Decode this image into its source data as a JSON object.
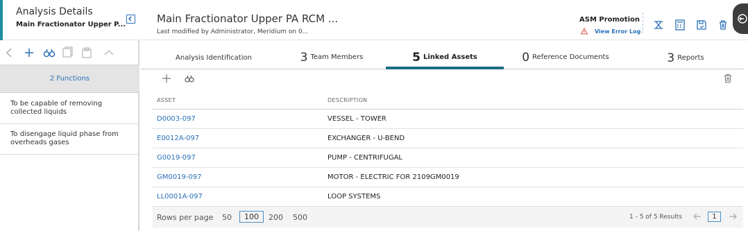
{
  "left_panel": {
    "title": "Analysis Details",
    "subtitle": "Main Fractionator Upper P...",
    "functions_header": "2 Functions",
    "functions": [
      "To be capable of removing collected liquids",
      "To disengage liquid phase from overheads gases"
    ]
  },
  "header": {
    "title": "Main Fractionator Upper PA RCM ...",
    "subtitle": "Last modified by Administrator, Meridium on 0...",
    "promotion_label": "ASM Promotion",
    "error_log_link": "View Error Log"
  },
  "tabs": [
    {
      "count": "",
      "label": "Analysis Identification"
    },
    {
      "count": "3",
      "label": "Team Members"
    },
    {
      "count": "5",
      "label": "Linked Assets"
    },
    {
      "count": "0",
      "label": "Reference Documents"
    },
    {
      "count": "3",
      "label": "Reports"
    }
  ],
  "table": {
    "columns": [
      "ASSET",
      "DESCRIPTION"
    ],
    "rows": [
      {
        "asset": "D0003-097",
        "description": "VESSEL - TOWER"
      },
      {
        "asset": "E0012A-097",
        "description": "EXCHANGER - U-BEND"
      },
      {
        "asset": "G0019-097",
        "description": "PUMP - CENTRIFUGAL"
      },
      {
        "asset": "GM0019-097",
        "description": "MOTOR - ELECTRIC FOR 2109GM0019"
      },
      {
        "asset": "LL0001A-097",
        "description": "LOOP SYSTEMS"
      }
    ]
  },
  "pagination": {
    "rows_per_page_label": "Rows per page",
    "options": [
      "50",
      "100",
      "200",
      "500"
    ],
    "selected": "100",
    "results": "1 - 5 of 5 Results",
    "current_page": "1"
  },
  "colors": {
    "accent": "#1d8da3",
    "link": "#2a70b8",
    "active_tab": "#1d6f80"
  }
}
